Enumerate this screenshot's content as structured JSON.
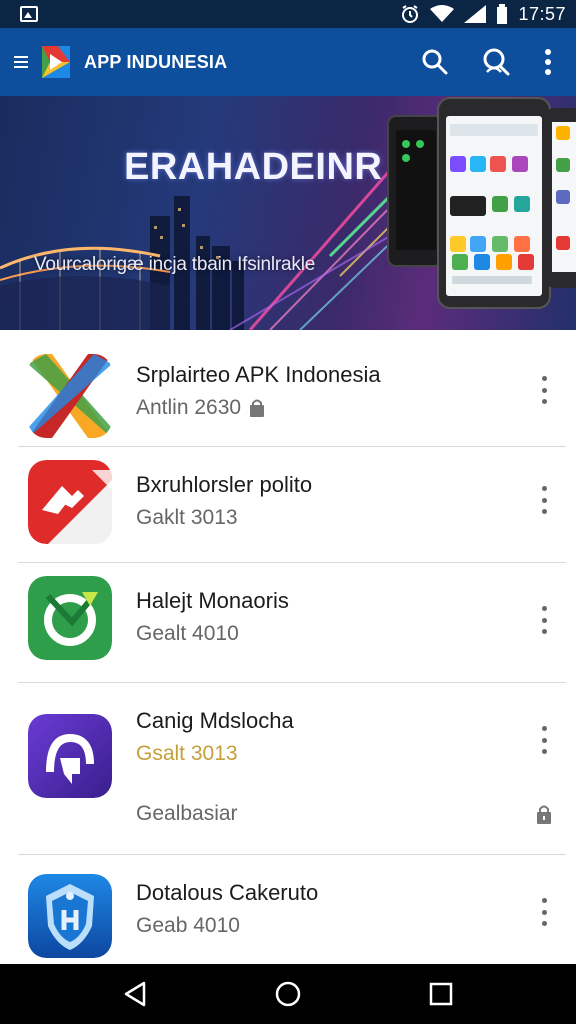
{
  "status_bar": {
    "time": "17:57",
    "icons": [
      "gallery-icon",
      "alarm-icon",
      "wifi-icon",
      "signal-icon",
      "battery-icon"
    ]
  },
  "app_bar": {
    "title": "APP INDUNESIA",
    "icons": [
      "menu-icon",
      "search-icon",
      "profile-search-icon",
      "more-vert-icon"
    ]
  },
  "banner": {
    "title": "ERAHADEINR",
    "subtitle": "Vourcalorigæ incja tbain Ifsinlrakle"
  },
  "apps": [
    {
      "name": "Srplairteo APK Indonesia",
      "meta": "Antlin 2630",
      "meta_icon": "bag-icon",
      "icon": "x-logo-icon"
    },
    {
      "name": "Bxruhlorsler polito",
      "meta": "Gaklt 3013",
      "icon": "red-page-icon"
    },
    {
      "name": "Halejt Monaoris",
      "meta": "Gealt 4010",
      "icon": "green-refresh-icon"
    },
    {
      "name": "Canig Mdslocha",
      "meta": "Gsalt 3013",
      "extra": "Gealbasiar",
      "extra_icon": "lock-icon",
      "icon": "purple-arrow-icon"
    },
    {
      "name": "Dotalous Cakeruto",
      "meta": "Geab 4010",
      "icon": "blue-shield-icon"
    }
  ],
  "colors": {
    "status_bar": "#0b2545",
    "app_bar": "#0d4f9c",
    "meta_gold": "#c4a03a",
    "nav_bar": "#000000"
  },
  "nav_bar": {
    "icons": [
      "back-icon",
      "home-icon",
      "recents-icon"
    ]
  }
}
